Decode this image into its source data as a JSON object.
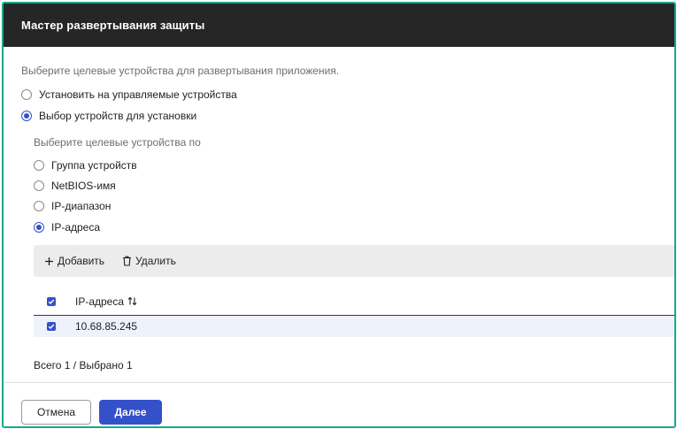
{
  "window": {
    "title": "Мастер развертывания защиты"
  },
  "intro_hint": "Выберите целевые устройства для развертывания приложения.",
  "install_mode": {
    "options": [
      {
        "label": "Установить на управляемые устройства",
        "checked": false
      },
      {
        "label": "Выбор устройств для установки",
        "checked": true
      }
    ]
  },
  "selection": {
    "hint": "Выберите целевые устройства по",
    "options": [
      {
        "label": "Группа устройств",
        "checked": false
      },
      {
        "label": "NetBIOS-имя",
        "checked": false
      },
      {
        "label": "IP-диапазон",
        "checked": false
      },
      {
        "label": "IP-адреса",
        "checked": true
      }
    ]
  },
  "toolbar": {
    "add_label": "Добавить",
    "delete_label": "Удалить"
  },
  "table": {
    "header": "IP-адреса",
    "rows": [
      {
        "value": "10.68.85.245",
        "checked": true
      }
    ],
    "summary": "Всего 1 / Выбрано 1"
  },
  "footer": {
    "cancel_label": "Отмена",
    "next_label": "Далее"
  },
  "colors": {
    "accent": "#3451c9",
    "header_bg": "#262626",
    "frame": "#16a889"
  }
}
